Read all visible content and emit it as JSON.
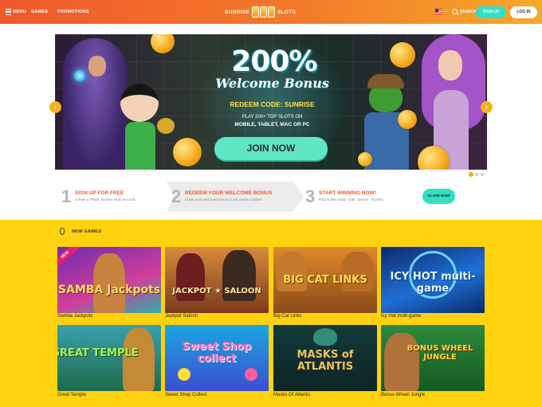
{
  "header": {
    "menu_label": "MENU",
    "nav": [
      "GAMES",
      "PROMOTIONS"
    ],
    "logo_left": "SUNRISE",
    "logo_right": "SLOTS",
    "search_label": "SEARCH",
    "signup_label": "SIGN UP",
    "login_label": "LOG IN",
    "flag_icon": "us-flag-icon"
  },
  "banner": {
    "headline": "200%",
    "subheadline": "Welcome Bonus",
    "redeem": "REDEEM CODE: SUNRISE",
    "play_line1": "PLAY 200+ TOP SLOTS ON",
    "play_line2": "MOBILE, TABLET, MAC OR PC",
    "cta": "JOIN NOW",
    "arrow_left": "‹",
    "arrow_right": "›",
    "slide_count": 3,
    "active_slide": 1
  },
  "steps": [
    {
      "number": "1",
      "title": "SIGN UP FOR FREE",
      "desc": "Create a FREE Sunrise Slots account."
    },
    {
      "number": "2",
      "title": "REDEEM YOUR WELCOME BONUS",
      "desc": "Claim your welcome bonus in our casino cashier."
    },
    {
      "number": "3",
      "title": "START WINNING NOW!",
      "desc": "Play & Win today. Safe. Secure. Trusted."
    }
  ],
  "claim_label": "CLAIM NOW",
  "games": {
    "section_title": "NEW GAMES",
    "new_badge": "NEW",
    "items": [
      {
        "title": "Samba Jackpots",
        "logo": "SAMBA Jackpots"
      },
      {
        "title": "Jackpot Saloon",
        "logo": "JACKPOT ★ SALOON"
      },
      {
        "title": "Big Cat Links",
        "logo": "BIG CAT LINKS"
      },
      {
        "title": "Icy Hot multi-game",
        "logo": "ICY HOT multi-game"
      },
      {
        "title": "Great Temple",
        "logo": "GREAT TEMPLE"
      },
      {
        "title": "Sweet Shop Collect",
        "logo": "Sweet Shop collect"
      },
      {
        "title": "Masks Of Atlantis",
        "logo": "MASKS of ATLANTIS"
      },
      {
        "title": "Bonus Wheel Jungle",
        "logo": "BONUS WHEEL JUNGLE"
      }
    ]
  },
  "colors": {
    "header_start": "#f0592b",
    "header_end": "#f6a92b",
    "accent_teal": "#2de2c8",
    "games_bg": "#ffd210",
    "step_title": "#f0592b"
  }
}
